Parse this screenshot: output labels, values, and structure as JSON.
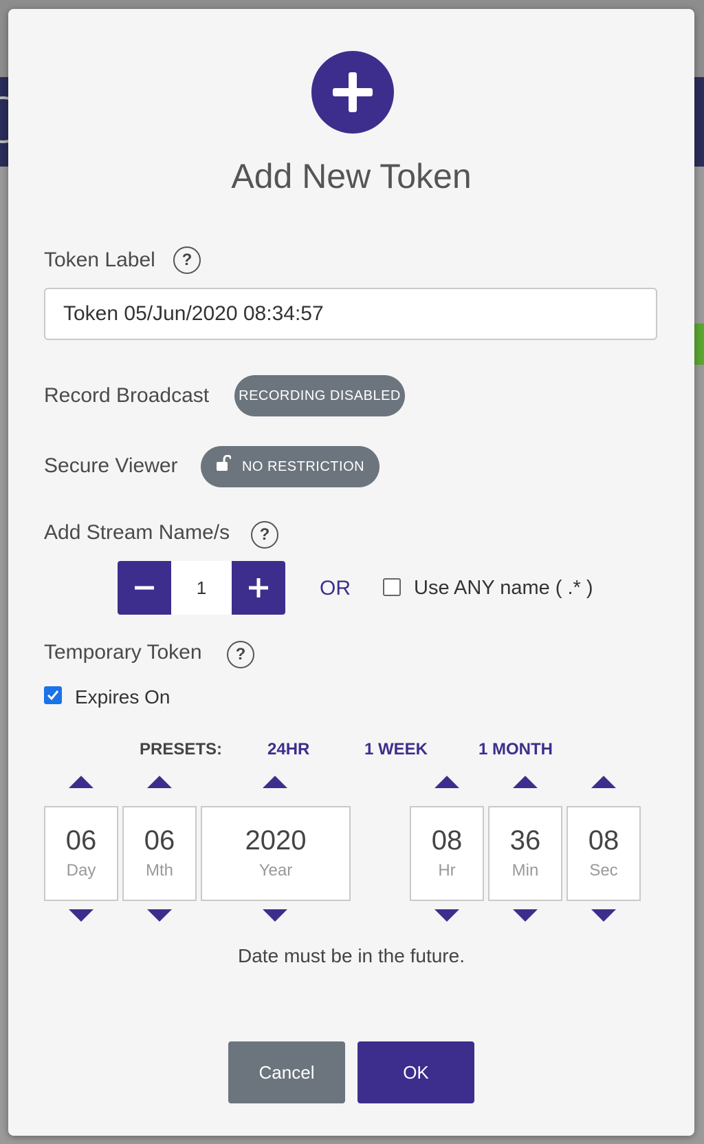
{
  "dialog": {
    "title": "Add New Token",
    "token_label": {
      "label": "Token Label",
      "help": "?",
      "value": "Token 05/Jun/2020 08:34:57"
    },
    "record_broadcast": {
      "label": "Record Broadcast",
      "toggle_text": "RECORDING DISABLED"
    },
    "secure_viewer": {
      "label": "Secure Viewer",
      "toggle_text": "NO RESTRICTION",
      "icon": "unlock-icon"
    },
    "stream_names": {
      "label": "Add Stream Name/s",
      "help": "?",
      "count": "1",
      "or_text": "OR",
      "any_name_label": "Use ANY name ( .* )",
      "any_name_checked": false
    },
    "temporary_token": {
      "label": "Temporary Token",
      "help": "?",
      "expires_label": "Expires On",
      "expires_checked": true
    },
    "presets": {
      "label": "PRESETS:",
      "items": [
        "24HR",
        "1 WEEK",
        "1 MONTH"
      ]
    },
    "date": {
      "day": {
        "value": "06",
        "unit": "Day"
      },
      "month": {
        "value": "06",
        "unit": "Mth"
      },
      "year": {
        "value": "2020",
        "unit": "Year"
      },
      "hour": {
        "value": "08",
        "unit": "Hr"
      },
      "minute": {
        "value": "36",
        "unit": "Min"
      },
      "second": {
        "value": "08",
        "unit": "Sec"
      }
    },
    "validation_message": "Date must be in the future.",
    "buttons": {
      "cancel": "Cancel",
      "ok": "OK"
    }
  },
  "colors": {
    "accent": "#3d2e8d",
    "toggle_grey": "#6c757d",
    "checkbox_blue": "#1a73e8"
  }
}
